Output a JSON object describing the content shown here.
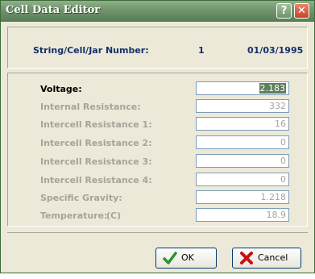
{
  "window": {
    "title": "Cell Data Editor",
    "help_label": "?",
    "close_label": "✕"
  },
  "header": {
    "label": "String/Cell/Jar Number:",
    "number": "1",
    "date": "01/03/1995"
  },
  "fields": [
    {
      "label": "Voltage:",
      "value": "2.183",
      "active": true
    },
    {
      "label": "Internal Resistance:",
      "value": "332"
    },
    {
      "label": "Intercell Resistance 1:",
      "value": "16"
    },
    {
      "label": "Intercell Resistance 2:",
      "value": "0"
    },
    {
      "label": "Intercell Resistance 3:",
      "value": "0"
    },
    {
      "label": "Intercell Resistance 4:",
      "value": "0"
    },
    {
      "label": "Specific Gravity:",
      "value": "1.218"
    },
    {
      "label": "Temperature:",
      "unit": "(C)",
      "value": "18.9"
    }
  ],
  "buttons": {
    "ok": "OK",
    "cancel": "Cancel"
  },
  "icons": {
    "ok": "checkmark-icon",
    "cancel": "red-x-icon"
  }
}
